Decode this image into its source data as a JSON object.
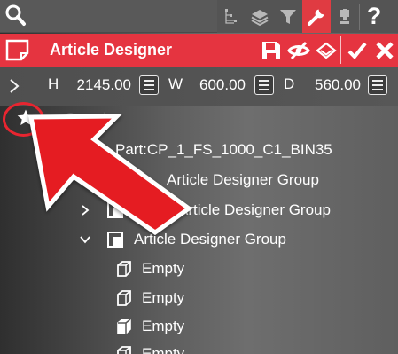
{
  "toolbar": {
    "icons": [
      "search-icon",
      "hierarchy-icon",
      "layers-icon",
      "filter-icon",
      "wrench-icon",
      "trophy-icon",
      "help-icon"
    ],
    "active_icon": "wrench-icon",
    "help_label": "?"
  },
  "title_bar": {
    "title": "Article Designer",
    "accent": "#e53440",
    "actions": [
      "save-icon",
      "visibility-off-icon",
      "layers-icon",
      "checkmark-icon",
      "close-icon"
    ]
  },
  "dimensions": {
    "height_label": "H",
    "height_value": "2145.00",
    "width_label": "W",
    "width_value": "600.00",
    "depth_label": "D",
    "depth_value": "560.00"
  },
  "search": {
    "placeholder": "Search",
    "value": ""
  },
  "tree": {
    "items": [
      {
        "label": "Part:CP_1_FS_1000_C1_BIN35",
        "icon": "part-icon",
        "expanded": false
      },
      {
        "label": "Article Designer Group",
        "icon": "group-icon",
        "expanded": false
      },
      {
        "label": "Article Designer Group",
        "icon": "group-icon",
        "expanded": false,
        "chevron": ">"
      },
      {
        "label": "Article Designer Group",
        "icon": "group-icon",
        "expanded": true,
        "chevron": "v"
      },
      {
        "label": "Empty",
        "icon": "empty-box-icon"
      },
      {
        "label": "Empty",
        "icon": "empty-box-icon"
      },
      {
        "label": "Empty",
        "icon": "empty-box-icon"
      },
      {
        "label": "Empty",
        "icon": "empty-box-icon"
      }
    ]
  },
  "annotations": {
    "highlight_color": "#e82530",
    "highlighted": "favorites-star-button"
  }
}
